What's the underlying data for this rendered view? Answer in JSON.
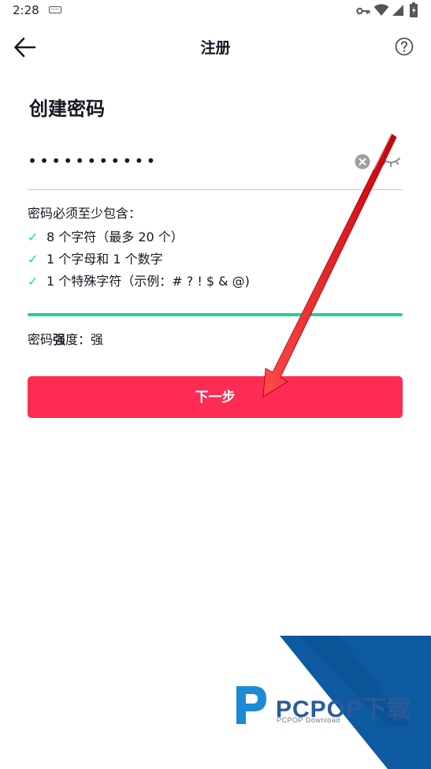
{
  "status_bar": {
    "time": "2:28",
    "icons": [
      "keyboard-icon",
      "key-icon",
      "wifi-icon",
      "signal-icon",
      "battery-icon"
    ]
  },
  "nav": {
    "title": "注册",
    "back_icon": "arrow-left-icon",
    "help_icon": "question-circle-icon"
  },
  "page": {
    "title": "创建密码"
  },
  "password_field": {
    "value": "•••••••••••",
    "clear_icon": "clear-icon",
    "visibility_icon": "eye-closed-icon"
  },
  "requirements": {
    "heading": "密码必须至少包含：",
    "items": [
      {
        "check": "✓",
        "label": "8 个字符（最多 20 个）"
      },
      {
        "check": "✓",
        "label": "1 个字母和 1 个数字"
      },
      {
        "check": "✓",
        "label": "1 个特殊字符（示例：# ? ! $ & @)"
      }
    ]
  },
  "strength": {
    "label": "密码",
    "label_bold": "强",
    "label_tail": "度：",
    "value": "强",
    "level": 1.0,
    "color": "#1fd199"
  },
  "next_button": {
    "label": "下一步",
    "color": "#fe2c55"
  },
  "annotation": {
    "color": "#e8101c"
  },
  "watermark": {
    "name": "PCPOP下载",
    "sub": "PCPOP Download"
  }
}
